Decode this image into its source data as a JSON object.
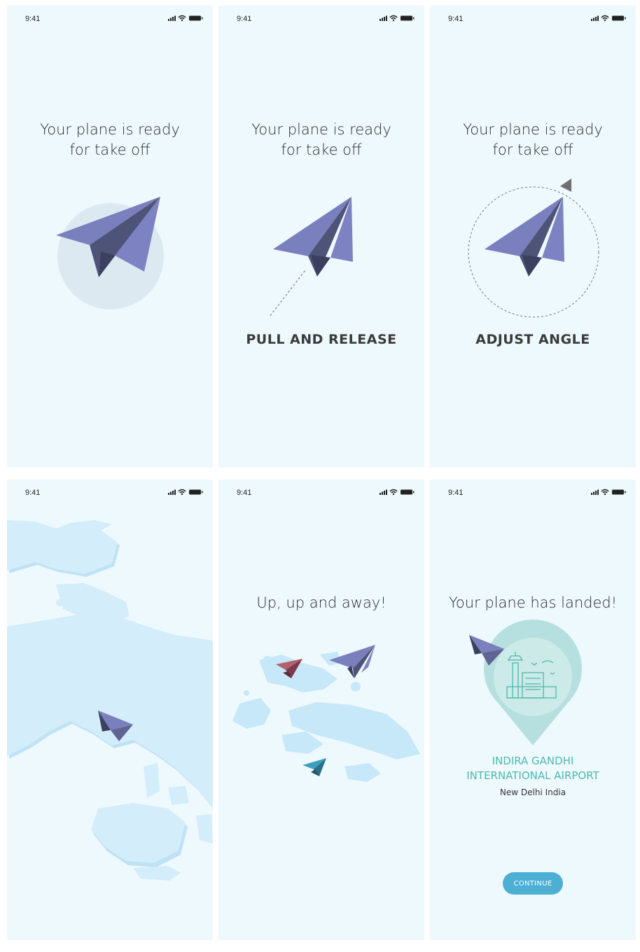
{
  "status_bar": {
    "time": "9:41"
  },
  "screens": [
    {
      "heading_line1": "Your plane is ready",
      "heading_line2": "for take off"
    },
    {
      "heading_line1": "Your plane is ready",
      "heading_line2": "for take off",
      "action": "PULL AND RELEASE"
    },
    {
      "heading_line1": "Your plane is ready",
      "heading_line2": "for take off",
      "action": "ADJUST ANGLE"
    },
    {},
    {
      "heading": "Up, up and away!"
    },
    {
      "heading": "Your plane has landed!",
      "airport_line1": "INDIRA GANDHI",
      "airport_line2": "INTERNATIONAL AIRPORT",
      "city": "New Delhi India",
      "continue_label": "CONTINUE"
    }
  ],
  "colors": {
    "background": "#eef9fd",
    "plane": "#7a80bd",
    "plane_dark": "#4e5378",
    "accent_teal": "#4fb7ad",
    "button": "#4dafd4",
    "map": "#cdeaf8"
  },
  "icons": [
    "signal-icon",
    "wifi-icon",
    "battery-icon",
    "paper-plane-icon",
    "airport-pin-icon"
  ]
}
